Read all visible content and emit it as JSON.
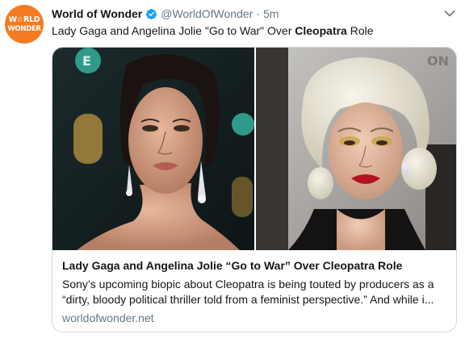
{
  "author": {
    "avatar_line1": "W☆RLD",
    "avatar_line2": "WONDER",
    "display_name": "World of Wonder",
    "handle": "@WorldOfWonder",
    "separator": "·",
    "time": "5m",
    "verified": true
  },
  "tweet": {
    "text_before": "Lady Gaga and Angelina Jolie \"Go to War\" Over ",
    "text_bold": "Cleopatra",
    "text_after": " Role"
  },
  "card": {
    "title": "Lady Gaga and Angelina Jolie “Go to War” Over Cleopatra Role",
    "description": "Sony’s upcoming biopic about Cleopatra is being touted by producers as a “dirty, bloody political thriller told from a feminist perspective.” And while i...",
    "domain": "worldofwonder.net"
  },
  "colors": {
    "brand_orange": "#f47b20",
    "verified_blue": "#1da1f2",
    "secondary_text": "#657786"
  },
  "icons": {
    "verified": "verified-badge-icon",
    "menu": "chevron-down-icon"
  }
}
